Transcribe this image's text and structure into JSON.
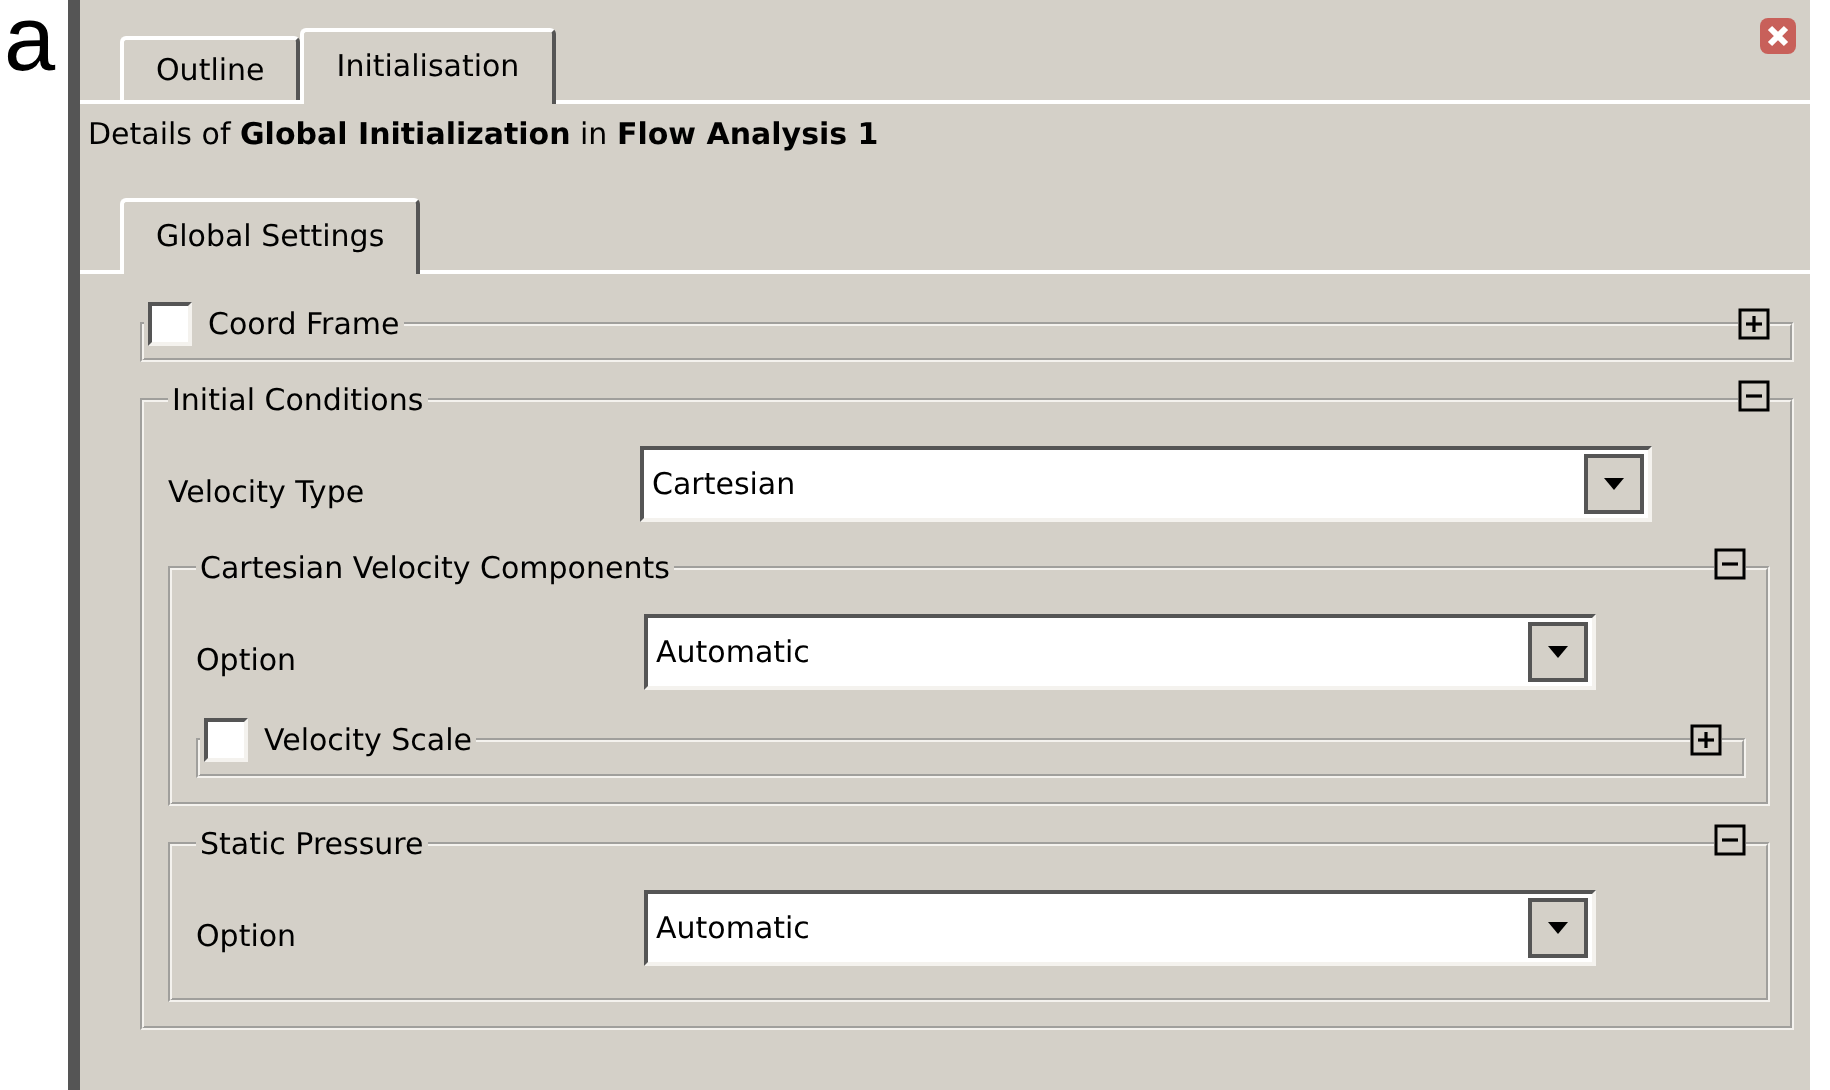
{
  "figure_label": "a",
  "tabs": [
    {
      "label": "Outline",
      "selected": false
    },
    {
      "label": "Initialisation",
      "selected": true
    }
  ],
  "details_title": "Details of **Global Initialization** in **Flow Analysis 1**",
  "inner_tabs": [
    {
      "label": "Global Settings",
      "selected": true
    }
  ],
  "sections": [
    {
      "kind": "group",
      "title": "Coord Frame",
      "checked": false,
      "expanded": false
    },
    {
      "kind": "group",
      "title": "Initial Conditions",
      "expanded": true,
      "children": [
        {
          "kind": "field",
          "label": "Velocity Type",
          "value": "Cartesian"
        },
        {
          "kind": "group",
          "title": "Cartesian Velocity Components",
          "expanded": true,
          "children": [
            {
              "kind": "field",
              "label": "Option",
              "value": "Automatic"
            },
            {
              "kind": "group",
              "title": "Velocity Scale",
              "checked": false,
              "expanded": false
            }
          ]
        },
        {
          "kind": "group",
          "title": "Static Pressure",
          "expanded": true,
          "children": [
            {
              "kind": "field",
              "label": "Option",
              "value": "Automatic"
            }
          ]
        }
      ]
    }
  ]
}
